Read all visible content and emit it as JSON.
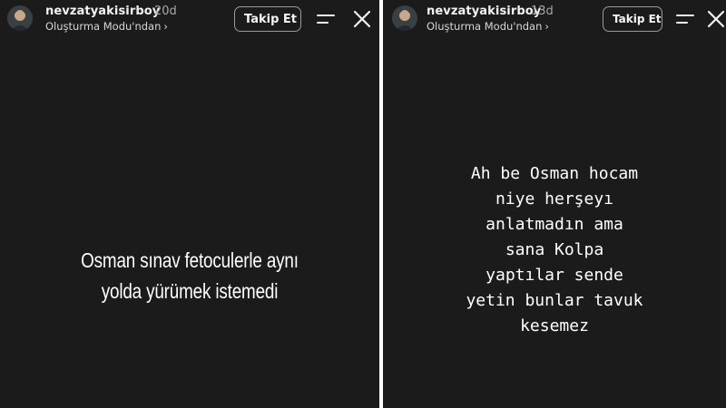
{
  "stories": [
    {
      "username": "nevzatyakisirboy",
      "time_ago": "20d",
      "subtitle": "Oluşturma Modu'ndan",
      "subtitle_chevron": "›",
      "follow_label": "Takip Et",
      "menu_icon": "menu-lines-icon",
      "close_icon": "close-icon",
      "text_lines": [
        "Osman sınav fetoculerle aynı",
        "yolda yürümek istemedi"
      ]
    },
    {
      "username": "nevzatyakisirboy",
      "time_ago": "13d",
      "subtitle": "Oluşturma Modu'ndan",
      "subtitle_chevron": "›",
      "follow_label": "Takip Et",
      "menu_icon": "menu-lines-icon",
      "close_icon": "close-icon",
      "text_lines": [
        "Ah be Osman hocam",
        "niye herşeyı",
        "anlatmadın ama",
        "sana Kolpa",
        "yaptılar sende",
        "yetin bunlar tavuk",
        "kesemez"
      ]
    }
  ],
  "colors": {
    "story_background": "#1b1b1b",
    "divider": "#ffffff",
    "text": "#ffffff",
    "muted": "#a8a8a8",
    "button_border": "#9a9a9a"
  }
}
